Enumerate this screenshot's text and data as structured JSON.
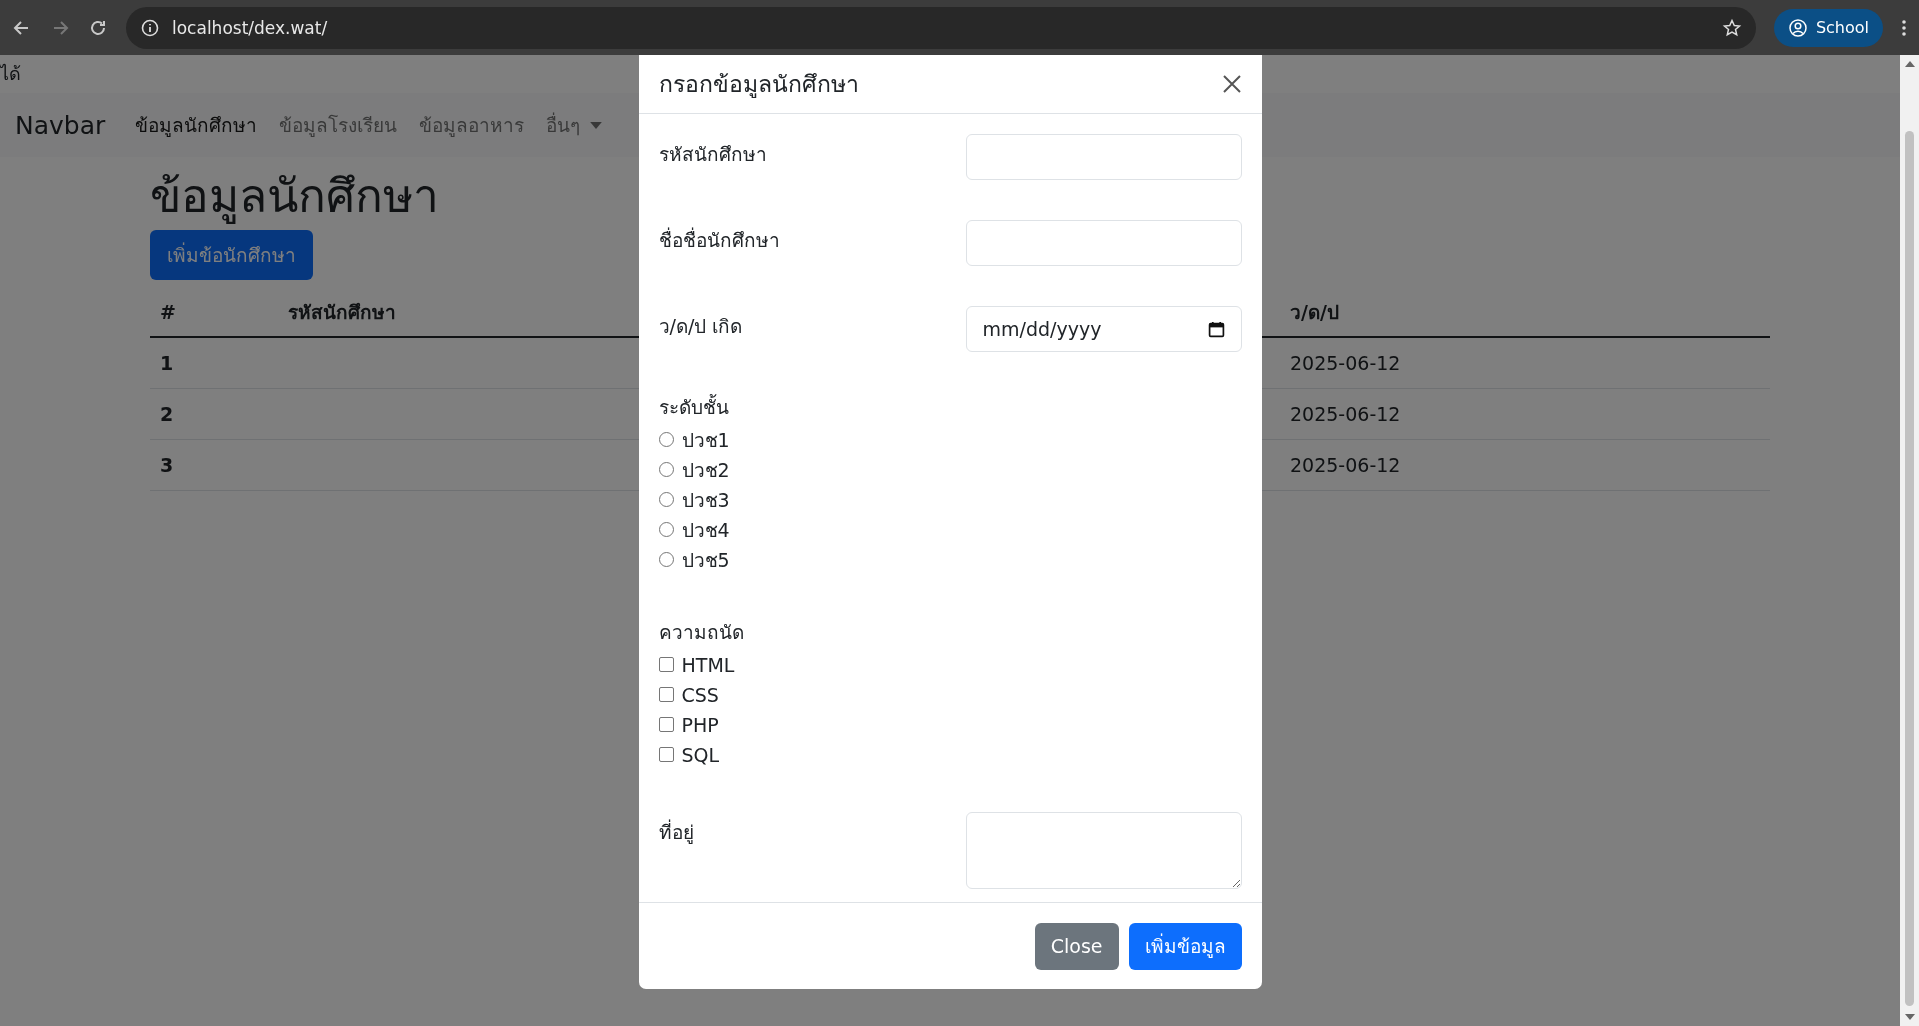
{
  "browser": {
    "url": "localhost/dex.wat/",
    "profile": "School"
  },
  "page": {
    "top_text": "ได้",
    "navbar": {
      "brand": "Navbar",
      "links": [
        {
          "label": "ข้อมูลนักศึกษา",
          "selected": true,
          "kind": "link"
        },
        {
          "label": "ข้อมูลโรงเรียน",
          "selected": false,
          "kind": "link"
        },
        {
          "label": "ข้อมูลอาหาร",
          "selected": false,
          "kind": "link"
        },
        {
          "label": "อื่นๆ",
          "selected": false,
          "kind": "dropdown"
        }
      ]
    },
    "heading": "ข้อมูลนักศึกษา",
    "add_button": "เพิ่มข้อนักศึกษา",
    "table": {
      "columns": [
        "#",
        "รหัสนักศึกษา",
        "ว/ด/ป"
      ],
      "rows": [
        {
          "number": "1",
          "date": "2025-06-12"
        },
        {
          "number": "2",
          "date": "2025-06-12"
        },
        {
          "number": "3",
          "date": "2025-06-12"
        }
      ]
    }
  },
  "modal": {
    "title": "กรอกข้อมูลนักศึกษา",
    "fields": [
      {
        "kind": "text",
        "label": "รหัสนักศึกษา"
      },
      {
        "kind": "text",
        "label": "ชื่อชื่อนักศึกษา"
      },
      {
        "kind": "date",
        "label": "ว/ด/ป เกิด",
        "placeholder": "mm/dd/yyyy"
      },
      {
        "kind": "radio",
        "label": "ระดับชั้น",
        "options": [
          {
            "label": "ปวช1",
            "selected": false
          },
          {
            "label": "ปวช2",
            "selected": false
          },
          {
            "label": "ปวช3",
            "selected": false
          },
          {
            "label": "ปวช4",
            "selected": false
          },
          {
            "label": "ปวช5",
            "selected": false
          }
        ]
      },
      {
        "kind": "checkbox",
        "label": "ความถนัด",
        "options": [
          {
            "label": "HTML",
            "checked": false
          },
          {
            "label": "CSS",
            "checked": false
          },
          {
            "label": "PHP",
            "checked": false
          },
          {
            "label": "SQL",
            "checked": false
          }
        ]
      },
      {
        "kind": "textarea",
        "label": "ที่อยู่"
      }
    ],
    "buttons": [
      {
        "label": "Close",
        "kind": "secondary"
      },
      {
        "label": "เพิ่มข้อมูล",
        "kind": "primary"
      }
    ]
  }
}
